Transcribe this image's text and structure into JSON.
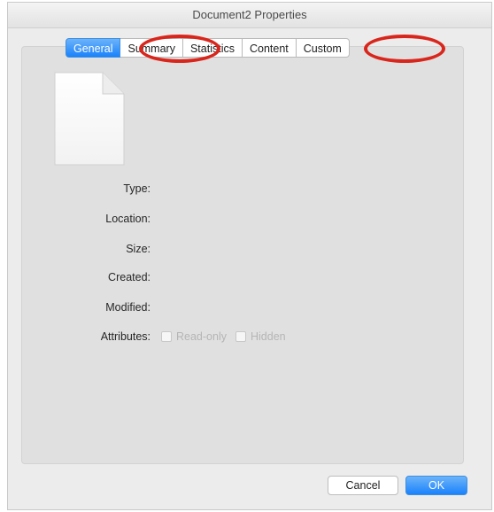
{
  "window": {
    "title": "Document2 Properties"
  },
  "tabs": [
    {
      "label": "General",
      "active": true
    },
    {
      "label": "Summary",
      "active": false,
      "highlighted": true
    },
    {
      "label": "Statistics",
      "active": false
    },
    {
      "label": "Content",
      "active": false
    },
    {
      "label": "Custom",
      "active": false,
      "highlighted": true
    }
  ],
  "general": {
    "icon": "blank-document-icon",
    "fields": {
      "type_label": "Type:",
      "location_label": "Location:",
      "size_label": "Size:",
      "created_label": "Created:",
      "modified_label": "Modified:",
      "attributes_label": "Attributes:"
    },
    "attributes": {
      "read_only_label": "Read-only",
      "read_only_checked": false,
      "hidden_label": "Hidden",
      "hidden_checked": false
    }
  },
  "buttons": {
    "cancel_label": "Cancel",
    "ok_label": "OK"
  },
  "colors": {
    "accent": "#1a82fb",
    "annotation": "#d9261c"
  }
}
